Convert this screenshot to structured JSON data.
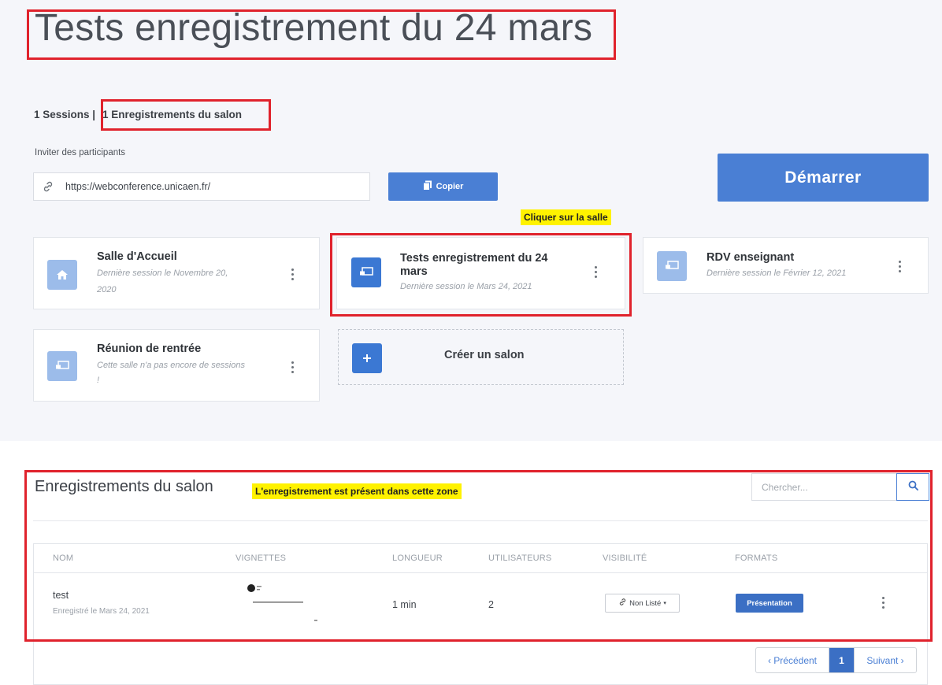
{
  "room": {
    "title": "Tests enregistrement du 24 mars"
  },
  "stats": {
    "sessions": "1 Sessions |",
    "recordings": "1 Enregistrements du salon"
  },
  "invite": {
    "label": "Inviter des participants",
    "url": "https://webconference.unicaen.fr/",
    "copy_label": "Copier"
  },
  "start_button": "Démarrer",
  "annotations": {
    "click_room": "Cliquer sur la salle",
    "recording_zone": "L'enregistrement est présent dans cette zone"
  },
  "rooms": [
    {
      "title": "Salle d'Accueil",
      "subtitle_line1": "Dernière session le Novembre 20,",
      "subtitle_line2": "2020",
      "icon": "home-icon"
    },
    {
      "title_line1": "Tests enregistrement du 24",
      "title_line2": "mars",
      "subtitle": "Dernière session le Mars 24, 2021",
      "icon": "room-icon"
    },
    {
      "title": "RDV enseignant",
      "subtitle": "Dernière session le Février 12, 2021",
      "icon": "room-icon"
    },
    {
      "title": "Réunion de rentrée",
      "subtitle_line1": "Cette salle n'a pas encore de sessions",
      "subtitle_line2": "!",
      "icon": "room-icon"
    }
  ],
  "create_room": {
    "label": "Créer un salon",
    "icon": "plus-icon"
  },
  "recordings": {
    "title": "Enregistrements du salon",
    "search_placeholder": "Chercher...",
    "columns": [
      "NOM",
      "VIGNETTES",
      "LONGUEUR",
      "UTILISATEURS",
      "VISIBILITÉ",
      "FORMATS"
    ],
    "rows": [
      {
        "name": "test",
        "date": "Enregistré le Mars 24, 2021",
        "length": "1 min",
        "users": "2",
        "visibility": "Non Listé",
        "format": "Présentation"
      }
    ]
  },
  "pagination": {
    "prev": "‹ Précédent",
    "current": "1",
    "next": "Suivant ›"
  },
  "colors": {
    "primary": "#4a7fd4",
    "annotation_red": "#e0222c",
    "highlight_yellow": "#fff200"
  }
}
